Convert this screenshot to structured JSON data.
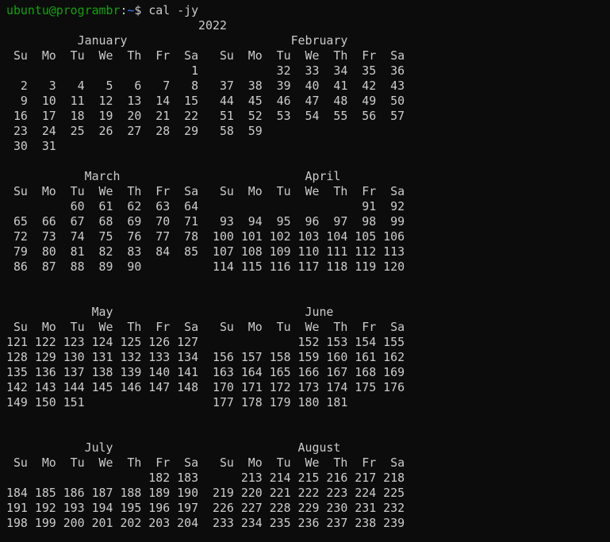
{
  "prompt": {
    "user_host": "ubuntu@programbr",
    "separator": ":",
    "path": "~",
    "symbol": "$ ",
    "command": "cal -jy"
  },
  "colors": {
    "background": "#0c0c0c",
    "text": "#cccccc",
    "user_host": "#13a10e",
    "path": "#3b78ff"
  },
  "output_lines": [
    "                           2022",
    "          January                       February",
    " Su  Mo  Tu  We  Th  Fr  Sa   Su  Mo  Tu  We  Th  Fr  Sa",
    "                          1           32  33  34  35  36",
    "  2   3   4   5   6   7   8   37  38  39  40  41  42  43",
    "  9  10  11  12  13  14  15   44  45  46  47  48  49  50",
    " 16  17  18  19  20  21  22   51  52  53  54  55  56  57",
    " 23  24  25  26  27  28  29   58  59",
    " 30  31",
    "",
    "           March                          April",
    " Su  Mo  Tu  We  Th  Fr  Sa   Su  Mo  Tu  We  Th  Fr  Sa",
    "         60  61  62  63  64                       91  92",
    " 65  66  67  68  69  70  71   93  94  95  96  97  98  99",
    " 72  73  74  75  76  77  78  100 101 102 103 104 105 106",
    " 79  80  81  82  83  84  85  107 108 109 110 111 112 113",
    " 86  87  88  89  90          114 115 116 117 118 119 120",
    "",
    "",
    "            May                           June",
    " Su  Mo  Tu  We  Th  Fr  Sa   Su  Mo  Tu  We  Th  Fr  Sa",
    "121 122 123 124 125 126 127              152 153 154 155",
    "128 129 130 131 132 133 134  156 157 158 159 160 161 162",
    "135 136 137 138 139 140 141  163 164 165 166 167 168 169",
    "142 143 144 145 146 147 148  170 171 172 173 174 175 176",
    "149 150 151                  177 178 179 180 181",
    "",
    "",
    "           July                          August",
    " Su  Mo  Tu  We  Th  Fr  Sa   Su  Mo  Tu  We  Th  Fr  Sa",
    "                    182 183      213 214 215 216 217 218",
    "184 185 186 187 188 189 190  219 220 221 222 223 224 225",
    "191 192 193 194 195 196 197  226 227 228 229 230 231 232",
    "198 199 200 201 202 203 204  233 234 235 236 237 238 239"
  ]
}
